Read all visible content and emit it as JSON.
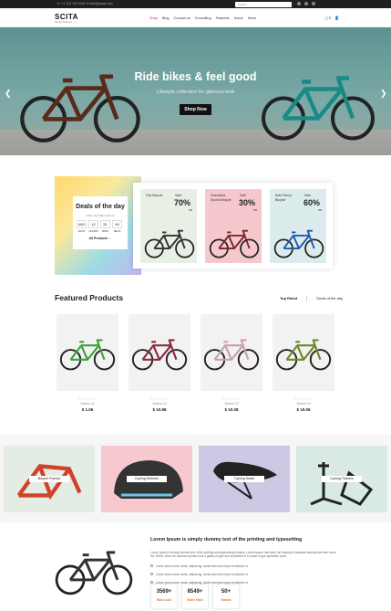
{
  "topbar": {
    "contact": "☏ +1 123 123 9002   ✉ info@gmail.com",
    "search_placeholder": "Search"
  },
  "logo": {
    "name": "SCITA",
    "tagline": "Simple Solutions"
  },
  "nav": [
    "Shop",
    "Blog",
    "Contact us",
    "Consulting",
    "Features",
    "Home",
    "Items"
  ],
  "header_icons": {
    "cart": "🛒0",
    "user": "👤"
  },
  "hero": {
    "title": "Ride bikes & feel good",
    "subtitle": "Lifestyle collection for glamour look",
    "button": "Shop Now",
    "prev": "❮",
    "next": "❯"
  },
  "deals": {
    "title": "Deals of the day",
    "subtitle": "Hurry Up! Offer ends in",
    "countdown": [
      {
        "value": "462",
        "unit": "DAYS"
      },
      {
        "value": "12",
        "unit": "HOURS"
      },
      {
        "value": "51",
        "unit": "MINS"
      },
      {
        "value": "49",
        "unit": "SECS"
      }
    ],
    "all_link": "All Products →"
  },
  "offers": [
    {
      "title": "City Bicycle",
      "sale": "Sale",
      "percent": "70%",
      "off": "Off",
      "bg": "#e8efe4"
    },
    {
      "title": "Oversized Sports Bicycle",
      "sale": "Sale",
      "percent": "30%",
      "off": "Off",
      "bg": "#f6c8cd"
    },
    {
      "title": "Kids Fancy Bicycle",
      "sale": "Sale",
      "percent": "60%",
      "off": "Off",
      "bg": "#dcecec"
    }
  ],
  "featured": {
    "title": "Featured Products",
    "tabs": [
      "Top Rated",
      "Deals of the day"
    ],
    "products": [
      {
        "stars": "☆☆☆☆☆",
        "name": "Scarcs 11",
        "price": "$ 1.06"
      },
      {
        "stars": "☆☆☆☆☆",
        "name": "Scarcs 12",
        "price": "$ 10.98"
      },
      {
        "stars": "☆☆☆☆☆",
        "name": "Queen 13",
        "price": "$ 10.08"
      },
      {
        "stars": "☆☆☆☆☆",
        "name": "Queen 14",
        "price": "$ 19.06"
      }
    ]
  },
  "categories": [
    {
      "label": "Bicycle Frames",
      "bg": "#e3ede4"
    },
    {
      "label": "Cycling Helmets",
      "bg": "#f7c9ce"
    },
    {
      "label": "Cycling Seats",
      "bg": "#cdc8e4"
    },
    {
      "label": "Cycling Trainers",
      "bg": "#d9e9e6"
    }
  ],
  "about": {
    "heading": "Lorem Ipsum is simply dummy text of the printing and typesetting",
    "body": "Lorem Ipsum is simply dummy text of the printing and typesetting industry. Lorem Ipsum has been the industry's standard dummy text ever since the 1500s, when an unknown printer took a galley of type and scrambled it to make a type specimen book.",
    "checks": [
      "Lorem ipsum dolor amet, adipiscing, iacitis sinemed empor incididunt ut",
      "Lorem ipsum dolor amet, adipiscing, iacitis sinemed empor incididunt ut",
      "Lorem ipsum dolor amet, adipiscing, iacitis sinemed empor incididunt ut"
    ],
    "stats": [
      {
        "value": "3569+",
        "label": "Bikes sold"
      },
      {
        "value": "8549+",
        "label": "Bikes fitted"
      },
      {
        "value": "50+",
        "label": "Brands"
      }
    ]
  },
  "colors": {
    "accent": "#d23228",
    "stat_label": "#e8792a",
    "hero_bg": "#6e9e9c"
  }
}
